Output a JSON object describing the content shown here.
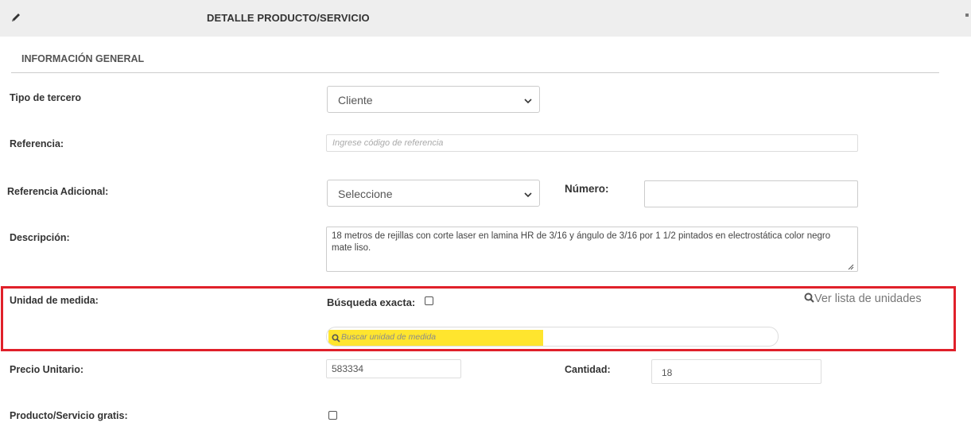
{
  "header": {
    "title": "DETALLE PRODUCTO/SERVICIO",
    "icon": "pencil-icon"
  },
  "section": {
    "title": "INFORMACIÓN GENERAL"
  },
  "form": {
    "tipo_tercero": {
      "label": "Tipo de tercero",
      "value": "Cliente"
    },
    "referencia": {
      "label": "Referencia:",
      "placeholder": "Ingrese código de referencia",
      "value": ""
    },
    "referencia_adicional": {
      "label": "Referencia Adicional:",
      "value": "Seleccione"
    },
    "numero": {
      "label": "Número:",
      "value": ""
    },
    "descripcion": {
      "label": "Descripción:",
      "value": "18 metros de rejillas con corte laser en lamina HR de 3/16 y ángulo de 3/16 por 1 1/2 pintados en electrostática color negro mate liso."
    },
    "unidad_medida": {
      "label": "Unidad de medida:",
      "busqueda_exacta_label": "Búsqueda exacta:",
      "busqueda_exacta_checked": false,
      "search_placeholder": "Buscar unidad de medida",
      "ver_lista_link": "Ver lista de unidades"
    },
    "precio_unitario": {
      "label": "Precio Unitario:",
      "value": "583334"
    },
    "cantidad": {
      "label": "Cantidad:",
      "value": "18"
    },
    "gratis": {
      "label": "Producto/Servicio gratis:",
      "checked": false
    }
  },
  "colors": {
    "highlight_border": "#e0202a",
    "search_highlight": "#ffe52e",
    "header_bg": "#eeeeee"
  }
}
